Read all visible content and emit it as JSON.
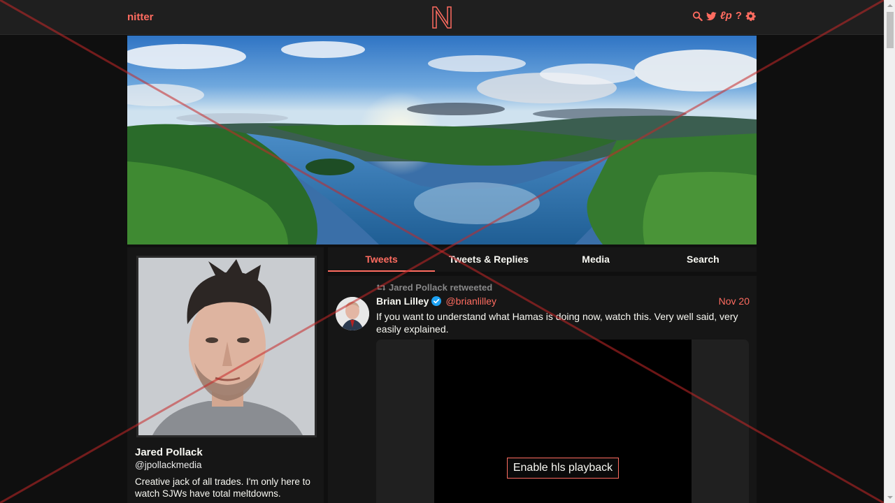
{
  "navbar": {
    "brand": "nitter",
    "logo_letter": "N",
    "icons": [
      "search-icon",
      "bird-icon",
      "lp-icon",
      "help-icon",
      "gear-icon"
    ],
    "lp_label": "ℓp",
    "help_label": "?"
  },
  "profile": {
    "fullname": "Jared Pollack",
    "username": "@jpollackmedia",
    "bio": "Creative jack of all trades. I'm only here to watch SJWs have total meltdowns."
  },
  "tabs": [
    {
      "label": "Tweets",
      "active": true
    },
    {
      "label": "Tweets & Replies",
      "active": false
    },
    {
      "label": "Media",
      "active": false
    },
    {
      "label": "Search",
      "active": false
    }
  ],
  "tweet": {
    "retweet_header": "Jared Pollack retweeted",
    "fullname": "Brian Lilley",
    "handle": "@brianlilley",
    "date": "Nov 20",
    "text": "If you want to understand what Hamas is doing now, watch this. Very well said, very easily explained.",
    "video_button": "Enable hls playback"
  },
  "colors": {
    "accent": "#ff6c60",
    "background": "#0f0f0f",
    "panel": "#161616",
    "verified": "#1da1f2"
  }
}
